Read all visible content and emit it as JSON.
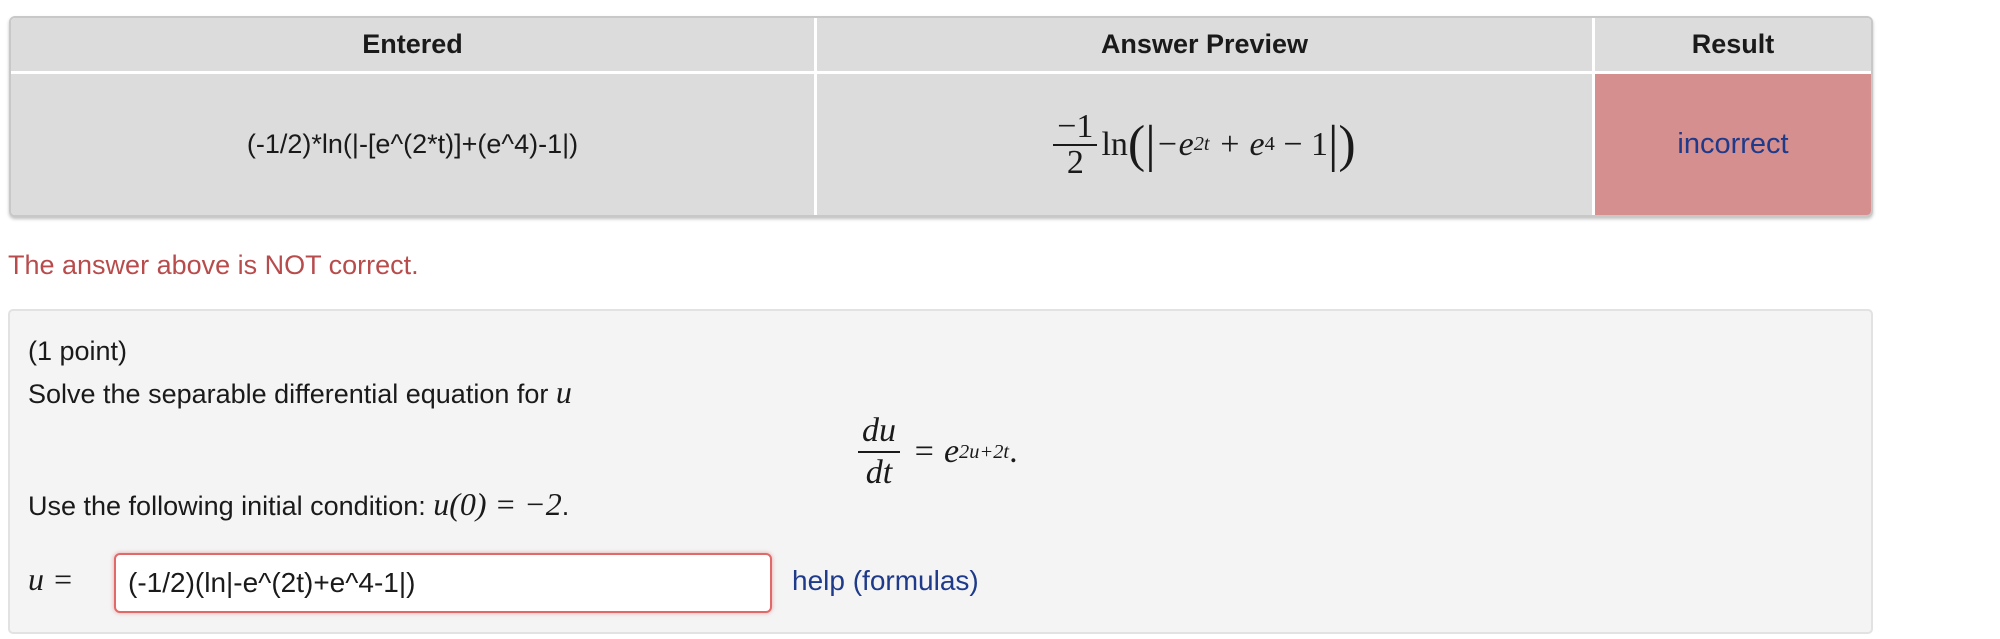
{
  "results_table": {
    "headers": [
      "Entered",
      "Answer Preview",
      "Result"
    ],
    "entered": "(-1/2)*ln(|-[e^(2*t)]+(e^4)-1|)",
    "preview": {
      "numerator": "−1",
      "denominator": "2",
      "fn": "ln",
      "lparen": "(",
      "bar_open": "|",
      "minus_e": "−e",
      "exp1": "2t",
      "plus_e": " + e",
      "exp2": "4",
      "minus_one": " − 1",
      "bar_close": "|",
      "rparen": ")"
    },
    "result": "incorrect"
  },
  "status_message": "The answer above is NOT correct.",
  "problem": {
    "points": "(1 point)",
    "prompt": "Solve the separable differential equation for",
    "prompt_var": "u",
    "equation": {
      "num": "du",
      "den": "dt",
      "eq": " = e",
      "exp": "2u+2t",
      "end": "."
    },
    "condition_text": "Use the following initial condition:",
    "condition_math": "u(0) = −2",
    "condition_end": ".",
    "answer_label": "u =",
    "answer_value": "(-1/2)(ln|-e^(2t)+e^4-1|)",
    "help_link": "help (formulas)"
  },
  "colors": {
    "incorrect_bg": "#d68f8f",
    "error_text": "#b84c4c",
    "link": "#1e3a8a",
    "input_border": "#e06a6a"
  }
}
